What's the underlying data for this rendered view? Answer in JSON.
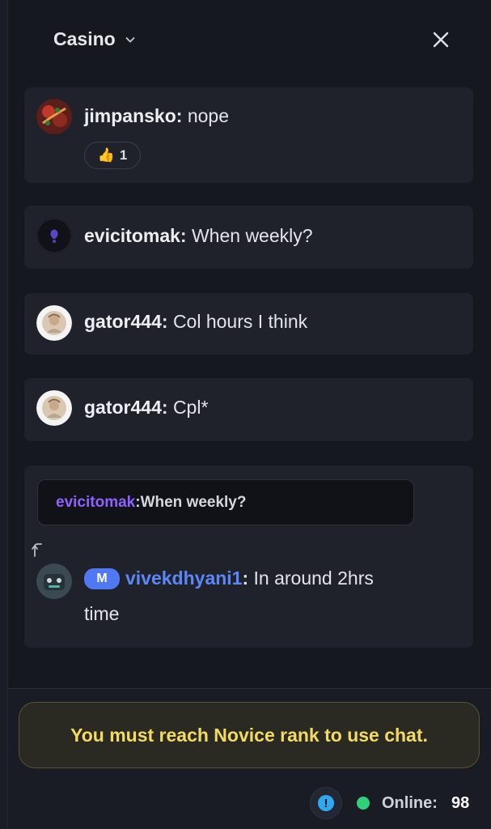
{
  "header": {
    "title": "Casino",
    "dropdown_icon": "chevron-down-icon",
    "close_icon": "close-icon"
  },
  "messages": [
    {
      "username": "jimpansko",
      "separator": ": ",
      "text": "nope",
      "avatar_icon": "avatar-icon",
      "reaction": {
        "emoji": "👍",
        "count": "1"
      }
    },
    {
      "username": "evicitomak",
      "separator": ": ",
      "text": "When weekly?",
      "avatar_icon": "avatar-icon"
    },
    {
      "username": "gator444",
      "separator": ": ",
      "text": "Col hours I think",
      "avatar_icon": "avatar-icon"
    },
    {
      "username": "gator444",
      "separator": ": ",
      "text": "Cpl*",
      "avatar_icon": "avatar-icon"
    },
    {
      "reply_to": {
        "username": "evicitomak",
        "separator": ": ",
        "text": "When weekly?"
      },
      "badge": "M",
      "username": "vivekdhyani1",
      "separator": ": ",
      "text_line1": "In around 2hrs",
      "text_line2": "time",
      "avatar_icon": "robot-avatar-icon"
    }
  ],
  "footer": {
    "notice": "You must reach Novice rank to use chat.",
    "info_icon": "info-icon",
    "info_glyph": "!",
    "online_label": "Online:",
    "online_count": "98"
  },
  "colors": {
    "background": "#15181f",
    "message_bg": "#1f222b",
    "notice_text": "#f3da63",
    "mention_purple": "#8f62ff",
    "moderator_blue": "#5c87f6",
    "online_green": "#2ed17a"
  }
}
